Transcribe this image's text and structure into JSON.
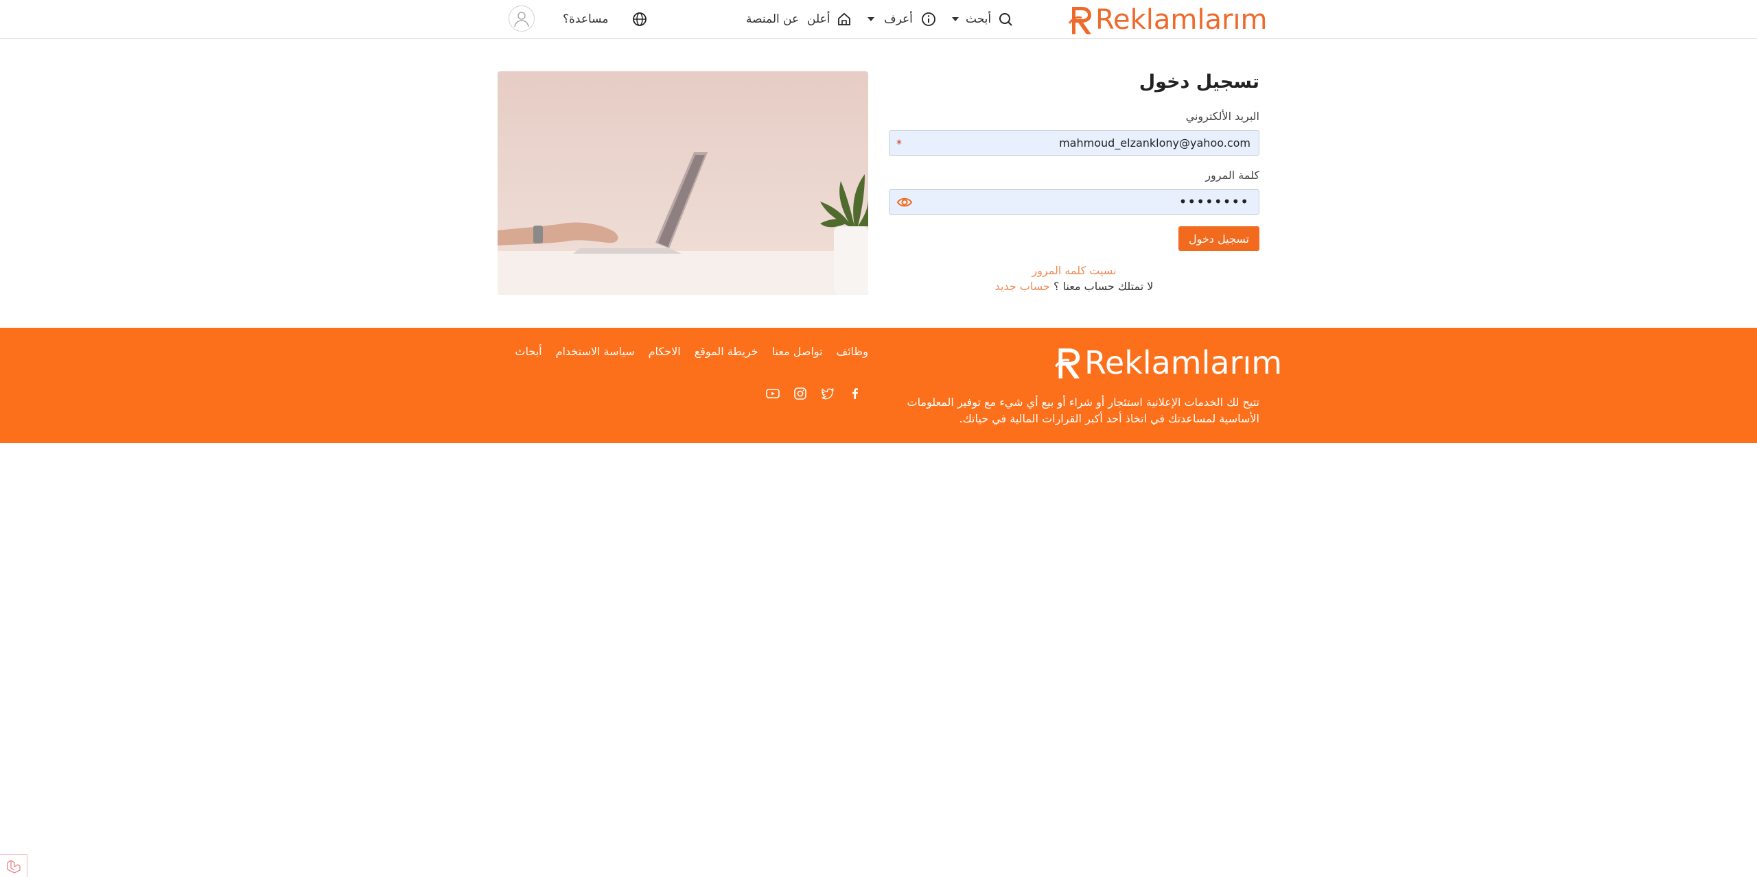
{
  "header": {
    "logo": "Reklamlarım",
    "nav": {
      "search": "أبحث",
      "learn": "أعرف",
      "advertise": "أعلن",
      "about": "عن المنصة",
      "help": "مساعدة؟"
    },
    "icons": {
      "search": "search-icon",
      "learn": "info-icon",
      "advertise": "home-icon",
      "language": "globe-icon",
      "user": "user-icon"
    }
  },
  "login": {
    "title": "تسجيل دخول",
    "email_label": "البريد الألكتروني",
    "email_value": "mahmoud_elzanklony@yahoo.com",
    "password_label": "كلمة المرور",
    "password_value": "••••••••",
    "required_mark": "*",
    "submit": "تسجيل دخول",
    "forgot": "نسيت كلمه المرور",
    "no_account": "لا تمتلك حساب معنا ؟",
    "new_account": "حساب جديد"
  },
  "footer": {
    "logo": "Reklamlarım",
    "description": "تتيح لك الخدمات الإعلانية استئجار أو شراء أو بيع أي شيء مع توفير المعلومات الأساسية لمساعدتك في اتخاذ أحد أكبر القرارات المالية في حياتك.",
    "links": [
      "وظائف",
      "تواصل معنا",
      "خريطة الموقع",
      "الاحكام",
      "سياسة الاستخدام",
      "أبحاث"
    ],
    "social": [
      "facebook-icon",
      "twitter-icon",
      "instagram-icon",
      "youtube-icon"
    ]
  },
  "colors": {
    "brand": "#f26a1e",
    "footer_bg": "#fc701b",
    "link": "#f08a55",
    "input_bg": "#e8f0fd"
  }
}
